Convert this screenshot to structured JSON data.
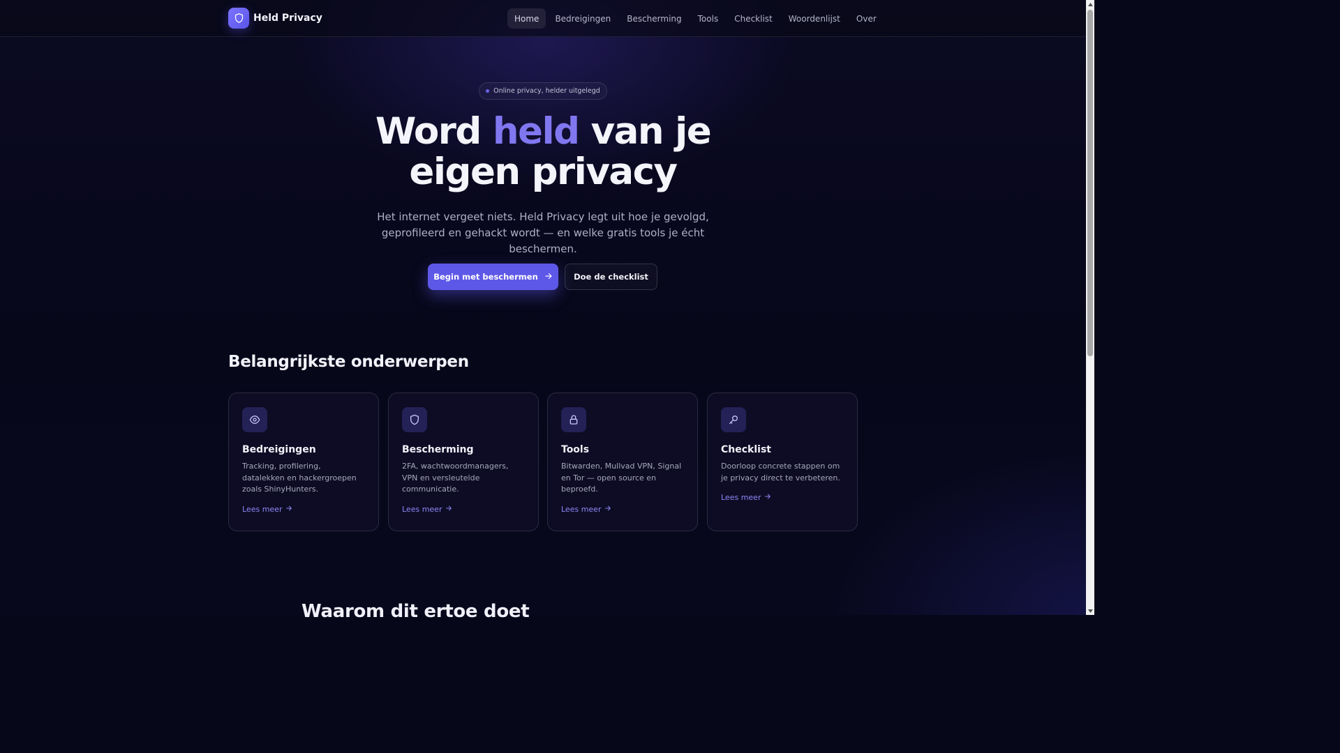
{
  "header": {
    "brand_name": "Held Privacy",
    "logo_icon": "shield-icon",
    "nav": [
      "Home",
      "Bedreigingen",
      "Bescherming",
      "Tools",
      "Checklist",
      "Woordenlijst",
      "Over"
    ],
    "active_nav": "Home"
  },
  "hero": {
    "pill_text": "Online privacy, helder uitgelegd",
    "title_part1": "Word ",
    "title_accent": "held",
    "title_part2": " van je eigen privacy",
    "subtitle": "Het internet vergeet niets. Held Privacy legt uit hoe je gevolgd, geprofileerd en gehackt wordt — en welke gratis tools je écht beschermen.",
    "primary_button": "Begin met beschermen",
    "secondary_button": "Doe de checklist"
  },
  "topics": {
    "heading": "Belangrijkste onderwerpen",
    "cards": [
      {
        "icon": "eye-icon",
        "title": "Bedreigingen",
        "text": "Tracking, profilering, datalekken en hackergroepen zoals ShinyHunters.",
        "link": "Lees meer"
      },
      {
        "icon": "shield-icon",
        "title": "Bescherming",
        "text": "2FA, wachtwoordmanagers, VPN en versleutelde communicatie.",
        "link": "Lees meer"
      },
      {
        "icon": "lock-icon",
        "title": "Tools",
        "text": "Bitwarden, Mullvad VPN, Signal en Tor — open source en beproefd.",
        "link": "Lees meer"
      },
      {
        "icon": "key-icon",
        "title": "Checklist",
        "text": "Doorloop concrete stappen om je privacy direct te verbeteren.",
        "link": "Lees meer"
      }
    ]
  },
  "next_section": {
    "heading": "Waarom dit ertoe doet"
  },
  "colors": {
    "accent": "#5e58e8",
    "accent_text": "#8077f0",
    "background": "#07071a"
  }
}
